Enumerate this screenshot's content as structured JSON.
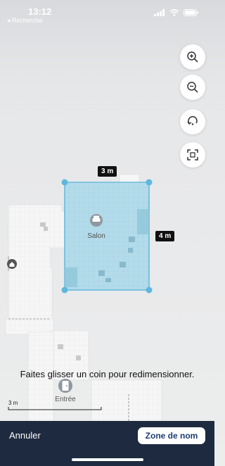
{
  "status_bar": {
    "time": "13:12",
    "back_label": "◂ Recherche"
  },
  "map": {
    "dimensions": {
      "width": "3 m",
      "height": "4 m"
    },
    "rooms": {
      "selected": "Salon",
      "other": "Entrée"
    },
    "scale_label": "3 m",
    "selection_color": "#5fb8dc"
  },
  "instruction": "Faites glisser un coin pour redimensionner.",
  "bottom_bar": {
    "cancel": "Annuler",
    "name_zone": "Zone de nom"
  },
  "icons": [
    "signal-icon",
    "wifi-icon",
    "battery-icon",
    "zoom-in-icon",
    "zoom-out-icon",
    "rotate-icon",
    "fit-screen-icon",
    "home-dock-icon",
    "sofa-icon",
    "door-icon"
  ]
}
